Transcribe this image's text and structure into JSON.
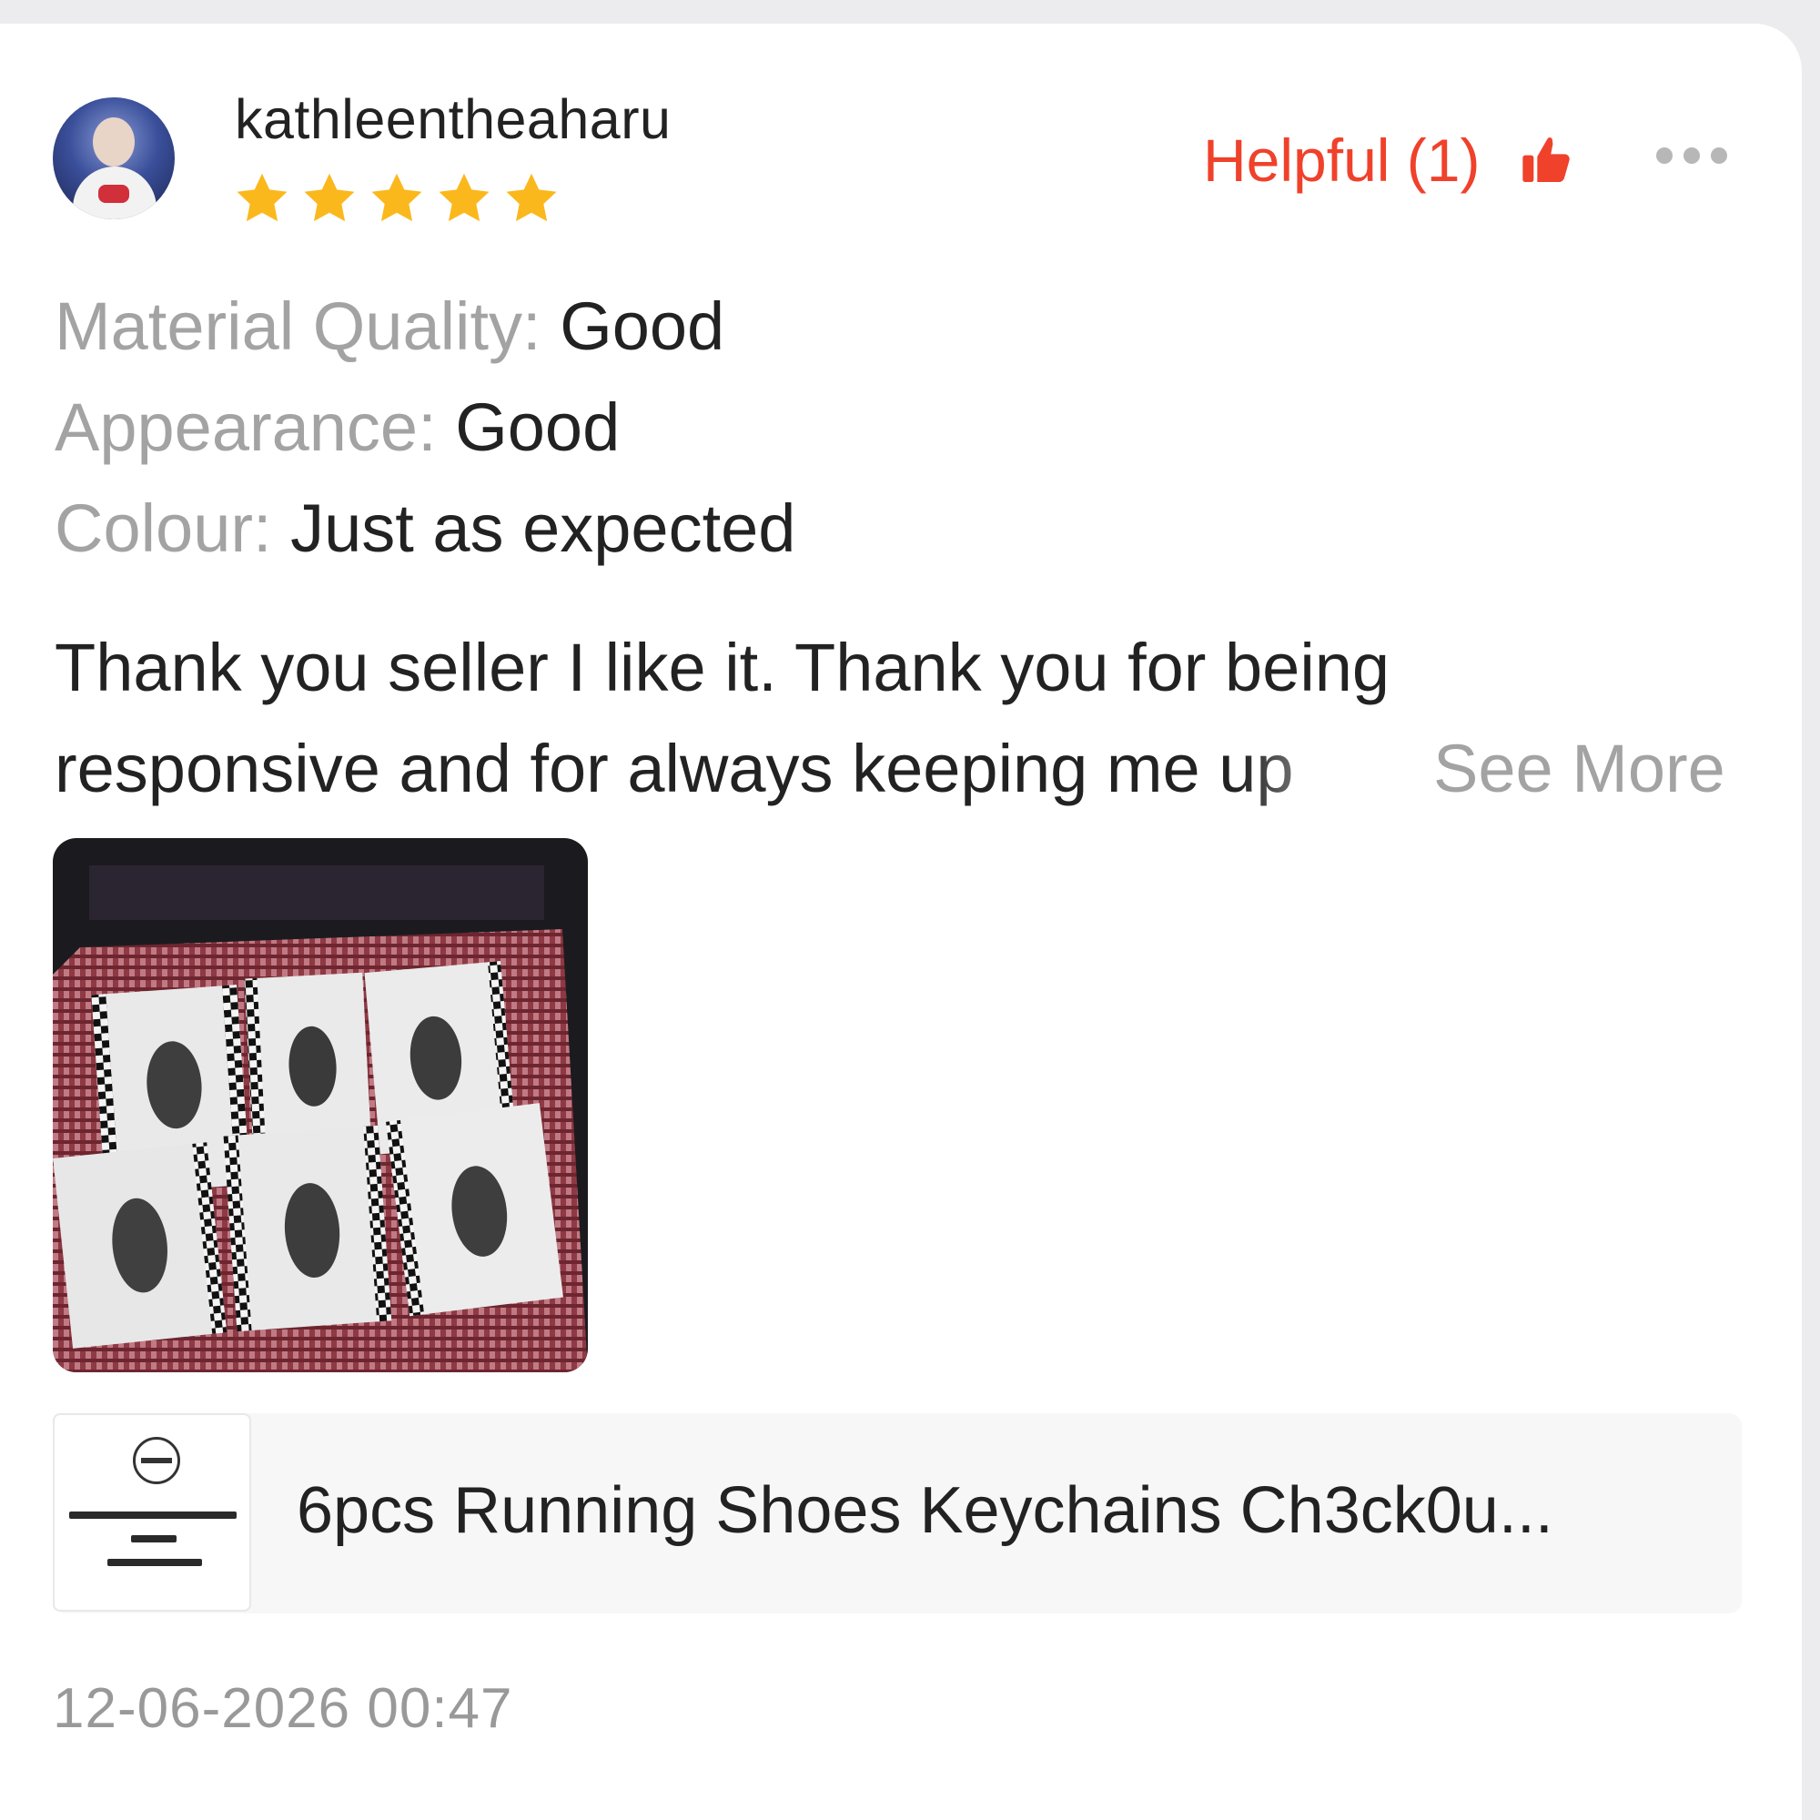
{
  "review": {
    "username": "kathleentheaharu",
    "rating": 5,
    "rating_max": 5,
    "helpful": {
      "label": "Helpful (1)"
    },
    "attributes": [
      {
        "key": "Material Quality:",
        "value": "Good"
      },
      {
        "key": "Appearance:",
        "value": "Good"
      },
      {
        "key": "Colour:",
        "value": "Just as expected"
      }
    ],
    "text_line1": "Thank you seller I like it. Thank you for being",
    "text_line2": "responsive and for always keeping me up",
    "see_more_label": "See More",
    "product_title": "6pcs Running Shoes Keychains Ch3ck0u...",
    "date": "12-06-2026 00:47"
  },
  "icons": {
    "star": "star-icon",
    "thumbs_up": "thumbs-up-icon",
    "more": "more-dots-icon"
  },
  "colors": {
    "accent": "#f0412b",
    "star": "#fbb81c",
    "muted_text": "#a3a3a3",
    "body_text": "#222222"
  }
}
